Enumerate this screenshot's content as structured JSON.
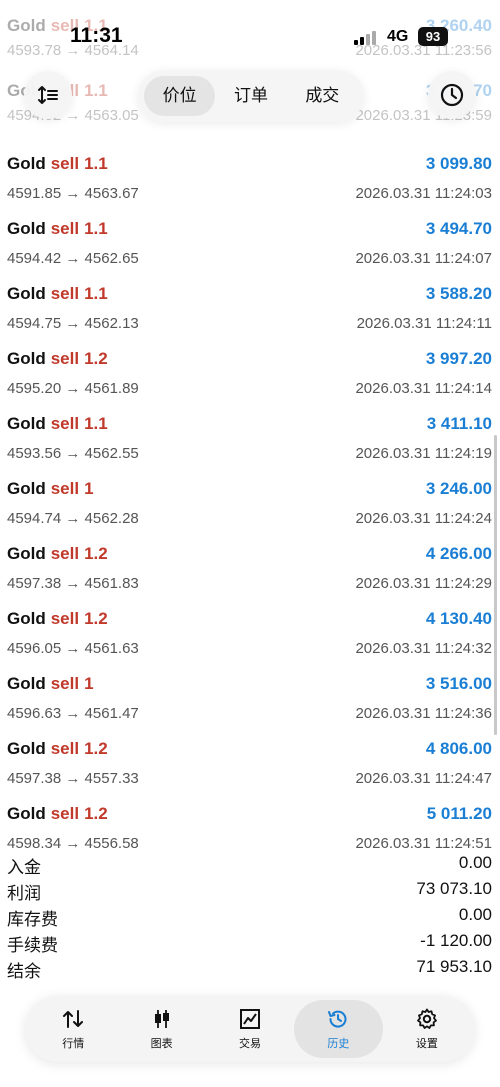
{
  "status_bar": {
    "time": "11:31",
    "network": "4G",
    "battery": "93"
  },
  "header": {
    "tabs": [
      {
        "label": "价位",
        "active": true
      },
      {
        "label": "订单",
        "active": false
      },
      {
        "label": "成交",
        "active": false
      }
    ]
  },
  "ghost_rows": [
    {
      "symbol": "Gold",
      "type": "sell",
      "volume": "1.1",
      "profit": "3 260.40",
      "prices": "4593.78 → 4564.14",
      "time": "2026.03.31 11:23:56"
    },
    {
      "symbol": "Gold",
      "type": "sell",
      "volume": "1.1",
      "profit": "3 452.70",
      "prices": "4594.02 → 4563.05",
      "time": "2026.03.31 11:23:59"
    }
  ],
  "deals": [
    {
      "symbol": "Gold",
      "type": "sell",
      "volume": "1.1",
      "profit": "3 099.80",
      "prices": "4591.85 → 4563.67",
      "time": "2026.03.31 11:24:03"
    },
    {
      "symbol": "Gold",
      "type": "sell",
      "volume": "1.1",
      "profit": "3 494.70",
      "prices": "4594.42 → 4562.65",
      "time": "2026.03.31 11:24:07"
    },
    {
      "symbol": "Gold",
      "type": "sell",
      "volume": "1.1",
      "profit": "3 588.20",
      "prices": "4594.75 → 4562.13",
      "time": "2026.03.31 11:24:11"
    },
    {
      "symbol": "Gold",
      "type": "sell",
      "volume": "1.2",
      "profit": "3 997.20",
      "prices": "4595.20 → 4561.89",
      "time": "2026.03.31 11:24:14"
    },
    {
      "symbol": "Gold",
      "type": "sell",
      "volume": "1.1",
      "profit": "3 411.10",
      "prices": "4593.56 → 4562.55",
      "time": "2026.03.31 11:24:19"
    },
    {
      "symbol": "Gold",
      "type": "sell",
      "volume": "1",
      "profit": "3 246.00",
      "prices": "4594.74 → 4562.28",
      "time": "2026.03.31 11:24:24"
    },
    {
      "symbol": "Gold",
      "type": "sell",
      "volume": "1.2",
      "profit": "4 266.00",
      "prices": "4597.38 → 4561.83",
      "time": "2026.03.31 11:24:29"
    },
    {
      "symbol": "Gold",
      "type": "sell",
      "volume": "1.2",
      "profit": "4 130.40",
      "prices": "4596.05 → 4561.63",
      "time": "2026.03.31 11:24:32"
    },
    {
      "symbol": "Gold",
      "type": "sell",
      "volume": "1",
      "profit": "3 516.00",
      "prices": "4596.63 → 4561.47",
      "time": "2026.03.31 11:24:36"
    },
    {
      "symbol": "Gold",
      "type": "sell",
      "volume": "1.2",
      "profit": "4 806.00",
      "prices": "4597.38 → 4557.33",
      "time": "2026.03.31 11:24:47"
    },
    {
      "symbol": "Gold",
      "type": "sell",
      "volume": "1.2",
      "profit": "5 011.20",
      "prices": "4598.34 → 4556.58",
      "time": "2026.03.31 11:24:51"
    }
  ],
  "summary": [
    {
      "label": "入金",
      "value": "0.00"
    },
    {
      "label": "利润",
      "value": "73 073.10"
    },
    {
      "label": "库存费",
      "value": "0.00"
    },
    {
      "label": "手续费",
      "value": "-1 120.00"
    },
    {
      "label": "结余",
      "value": "71 953.10"
    }
  ],
  "bottom_nav": [
    {
      "label": "行情",
      "icon": "quotes-icon",
      "active": false
    },
    {
      "label": "图表",
      "icon": "chart-candles-icon",
      "active": false
    },
    {
      "label": "交易",
      "icon": "trade-chart-icon",
      "active": false
    },
    {
      "label": "历史",
      "icon": "history-icon",
      "active": true
    },
    {
      "label": "设置",
      "icon": "settings-gear-icon",
      "active": false
    }
  ],
  "colors": {
    "profit": "#1a7fd4",
    "sell": "#c0392b",
    "active_nav": "#1a7fd4"
  }
}
